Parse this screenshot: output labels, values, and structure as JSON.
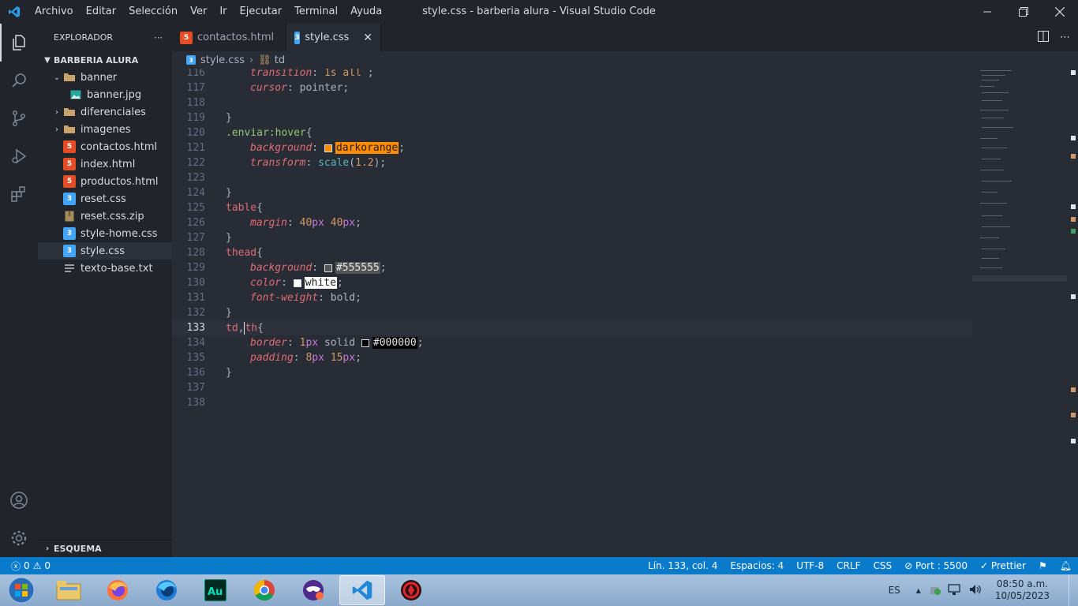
{
  "window": {
    "title": "style.css - barberia alura - Visual Studio Code",
    "menu": [
      "Archivo",
      "Editar",
      "Selección",
      "Ver",
      "Ir",
      "Ejecutar",
      "Terminal",
      "Ayuda"
    ]
  },
  "sidebar": {
    "header": "EXPLORADOR",
    "project": "BARBERIA ALURA",
    "items": [
      {
        "label": "banner",
        "type": "folder-open"
      },
      {
        "label": "banner.jpg",
        "type": "image"
      },
      {
        "label": "diferenciales",
        "type": "folder"
      },
      {
        "label": "imagenes",
        "type": "folder"
      },
      {
        "label": "contactos.html",
        "type": "html"
      },
      {
        "label": "index.html",
        "type": "html"
      },
      {
        "label": "productos.html",
        "type": "html"
      },
      {
        "label": "reset.css",
        "type": "css"
      },
      {
        "label": "reset.css.zip",
        "type": "zip"
      },
      {
        "label": "style-home.css",
        "type": "css"
      },
      {
        "label": "style.css",
        "type": "css"
      },
      {
        "label": "texto-base.txt",
        "type": "txt"
      }
    ],
    "outline": "ESQUEMA"
  },
  "tabs": [
    {
      "label": "contactos.html",
      "type": "html"
    },
    {
      "label": "style.css",
      "type": "css"
    }
  ],
  "breadcrumb": {
    "file": "style.css",
    "symbol": "td"
  },
  "editor": {
    "line_numbers": [
      "116",
      "117",
      "118",
      "119",
      "120",
      "121",
      "122",
      "123",
      "124",
      "125",
      "126",
      "127",
      "128",
      "129",
      "130",
      "131",
      "132",
      "133",
      "134",
      "135",
      "136",
      "137",
      "138"
    ],
    "current_line": "133",
    "tokens": {
      "l116_prop": "transition",
      "l116_val": "1s all",
      "l116_end": " ;",
      "l117_prop": "cursor",
      "l117_val": "pointer",
      "l120_sel": ".enviar:hover",
      "l121_prop": "background",
      "l121_val": "darkorange",
      "l122_prop": "transform",
      "l122_fn": "scale",
      "l122_num": "1.2",
      "l125_sel": "table",
      "l126_prop": "margin",
      "l126_a": "40",
      "l126_b": "40",
      "l128_sel": "thead",
      "l129_prop": "background",
      "l129_val": "#555555",
      "l130_prop": "color",
      "l130_val": "white",
      "l131_prop": "font-weight",
      "l131_val": "bold",
      "l133_a": "td",
      "l133_b": "th",
      "l134_prop": "border",
      "l134_n": "1",
      "l134_kw": "solid",
      "l134_val": "#000000",
      "l135_prop": "padding",
      "l135_a": "8",
      "l135_b": "15",
      "unit": "px"
    },
    "colors": {
      "darkorange": "#ff8c00",
      "gray": "#555555",
      "white": "#ffffff",
      "black": "#000000"
    }
  },
  "statusbar": {
    "problems": "0",
    "warnings": "0",
    "position": "Lín. 133, col. 4",
    "spaces": "Espacios: 4",
    "encoding": "UTF-8",
    "eol": "CRLF",
    "language": "CSS",
    "port": "Port : 5500",
    "formatter": "Prettier"
  },
  "taskbar": {
    "apps": [
      "file-explorer",
      "firefox",
      "firefox-developer",
      "adobe-audition",
      "chrome",
      "private-browser",
      "vscode",
      "gaming-app"
    ],
    "language": "ES",
    "time": "08:50 a.m.",
    "date": "10/05/2023"
  }
}
